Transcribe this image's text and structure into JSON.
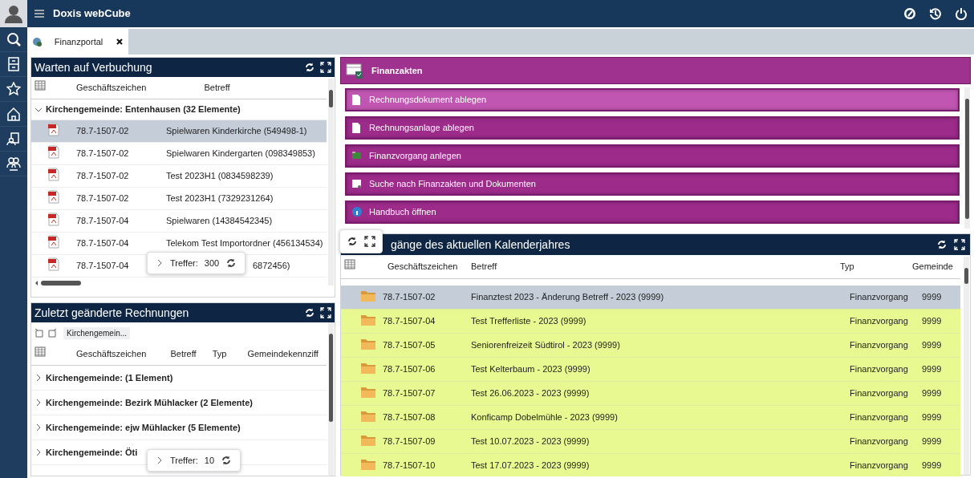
{
  "app": {
    "title": "Doxis webCube"
  },
  "tabs": [
    {
      "label": "Finanzportal",
      "selected": true
    }
  ],
  "pending": {
    "title": "Warten auf Verbuchung",
    "columns": [
      "Geschäftszeichen",
      "Betreff"
    ],
    "groups": [
      {
        "label": "Kirchengemeinde: Entenhausen (32 Elemente)",
        "expanded": true,
        "rows": [
          {
            "number": "78.7-1507-02",
            "subject": "Spielwaren Kinderkirche (549498-1)",
            "selected": true
          },
          {
            "number": "78.7-1507-02",
            "subject": "Spielwaren Kindergarten (098349853)",
            "selected": false
          },
          {
            "number": "78.7-1507-02",
            "subject": "Test 2023H1 (0834598239)",
            "selected": false
          },
          {
            "number": "78.7-1507-02",
            "subject": "Test 2023H1 (7329231264)",
            "selected": false
          },
          {
            "number": "78.7-1507-04",
            "subject": "Spielwaren (14384542345)",
            "selected": false
          },
          {
            "number": "78.7-1507-04",
            "subject": "Telekom Test Importordner (456134534)",
            "selected": false
          },
          {
            "number": "78.7-1507-04",
            "subject": "6872456)",
            "selected": false
          }
        ]
      }
    ],
    "hits": {
      "label": "Treffer:",
      "count": "300"
    }
  },
  "recent": {
    "title": "Zuletzt geänderte Rechnungen",
    "filter": "Kirchengemein...",
    "columns": [
      "Geschäftszeichen",
      "Betreff",
      "Typ",
      "Gemeindekennziff"
    ],
    "groups": [
      {
        "label": "Kirchengemeinde: (1 Element)",
        "expanded": false
      },
      {
        "label": "Kirchengemeinde: Bezirk Mühlacker (2 Elemente)",
        "expanded": false
      },
      {
        "label": "Kirchengemeinde: ejw Mühlacker (5 Elemente)",
        "expanded": false
      },
      {
        "label": "Kirchengemeinde: Öti",
        "expanded": false
      }
    ],
    "hits": {
      "label": "Treffer:",
      "count": "10"
    }
  },
  "finance": {
    "title": "Finanzakten",
    "actions": [
      {
        "label": "Rechnungsdokument ablegen",
        "selected": true
      },
      {
        "label": "Rechnungsanlage ablegen",
        "selected": false
      },
      {
        "label": "Finanzvorgang anlegen",
        "selected": false
      },
      {
        "label": "Suche nach Finanzakten und Dokumenten",
        "selected": false
      },
      {
        "label": "Handbuch öffnen",
        "selected": false
      }
    ]
  },
  "yearly": {
    "title": "gänge des aktuellen Kalenderjahres",
    "columns": [
      "Geschäftszeichen",
      "Betreff",
      "Typ",
      "Gemeinde"
    ],
    "rows": [
      {
        "number": "78.7-1507-02",
        "subject": "Finanztest 2023 - Änderung Betreff - 2023 (9999)",
        "type": "Finanzvorgang",
        "code": "9999",
        "selected": true
      },
      {
        "number": "78.7-1507-04",
        "subject": "Test Trefferliste - 2023 (9999)",
        "type": "Finanzvorgang",
        "code": "9999",
        "selected": false
      },
      {
        "number": "78.7-1507-05",
        "subject": "Seniorenfreizeit Südtirol - 2023 (9999)",
        "type": "Finanzvorgang",
        "code": "9999",
        "selected": false
      },
      {
        "number": "78.7-1507-06",
        "subject": "Test Kelterbaum - 2023 (9999)",
        "type": "Finanzvorgang",
        "code": "9999",
        "selected": false
      },
      {
        "number": "78.7-1507-07",
        "subject": "Test 26.06.2023 - 2023 (9999)",
        "type": "Finanzvorgang",
        "code": "9999",
        "selected": false
      },
      {
        "number": "78.7-1507-08",
        "subject": "Konficamp Dobelmühle - 2023 (9999)",
        "type": "Finanzvorgang",
        "code": "9999",
        "selected": false
      },
      {
        "number": "78.7-1507-09",
        "subject": "Test 10.07.2023 - 2023 (9999)",
        "type": "Finanzvorgang",
        "code": "9999",
        "selected": false
      },
      {
        "number": "78.7-1507-10",
        "subject": "Test 17.07.2023 - 2023 (9999)",
        "type": "Finanzvorgang",
        "code": "9999",
        "selected": false
      }
    ]
  }
}
